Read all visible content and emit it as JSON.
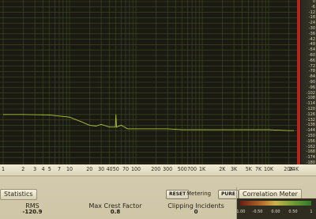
{
  "spectrum": {
    "db_ticks": [
      "0",
      "-6",
      "-12",
      "-18",
      "-24",
      "-30",
      "-36",
      "-42",
      "-48",
      "-54",
      "-60",
      "-66",
      "-72",
      "-78",
      "-84",
      "-90",
      "-96",
      "-102",
      "-108",
      "-114",
      "-120",
      "-126",
      "-132",
      "-138",
      "-144",
      "-150",
      "-156",
      "-162",
      "-168",
      "-174",
      "-180"
    ],
    "freq_ticks": [
      "1",
      "2",
      "3",
      "4",
      "5",
      "7",
      "10",
      "20",
      "30",
      "40",
      "50",
      "70",
      "100",
      "200",
      "300",
      "500",
      "700",
      "1K",
      "2K",
      "3K",
      "5K",
      "7K",
      "10K",
      "20K",
      "24K"
    ],
    "db_range": [
      -180,
      0
    ],
    "freq_range_hz": [
      1,
      24000
    ],
    "colors": {
      "trace": "#a9c23a",
      "background": "#1b1a12",
      "grid": "#3d4a24"
    }
  },
  "chart_data": {
    "type": "line",
    "xlabel": "",
    "ylabel": "",
    "xscale": "log",
    "xlim": [
      1,
      24000
    ],
    "ylim": [
      -180,
      0
    ],
    "series": [
      {
        "x": [
          1,
          2,
          5,
          10,
          15,
          20,
          25,
          30,
          40,
          49,
          50,
          51,
          60,
          75,
          100,
          150,
          200,
          300,
          500,
          700,
          1000,
          2000,
          3000,
          5000,
          7000,
          10000,
          20000,
          24000
        ],
        "y": [
          -126,
          -126,
          -126.5,
          -129,
          -134,
          -138,
          -139,
          -137,
          -140,
          -140,
          -126,
          -140,
          -138,
          -142,
          -142,
          -142,
          -142,
          -142,
          -143,
          -143,
          -143,
          -143,
          -143,
          -143,
          -143,
          -143,
          -144,
          -144
        ]
      }
    ]
  },
  "tabs": {
    "statistics": "Statistics",
    "correlation": "Correlation Meter"
  },
  "stats": {
    "rms_label": "RMS",
    "rms_value": "-120.9",
    "crest_label": "Max Crest Factor",
    "crest_value": "0.8",
    "clip_label": "Clipping Incidents",
    "clip_value": "0"
  },
  "metering": {
    "reset_label": "RESET",
    "metering_label": "Metering",
    "mode_label": "PURE"
  },
  "correlation": {
    "ticks": [
      "-1.00",
      "-0.50",
      "0.00",
      "0.50",
      "1"
    ]
  }
}
